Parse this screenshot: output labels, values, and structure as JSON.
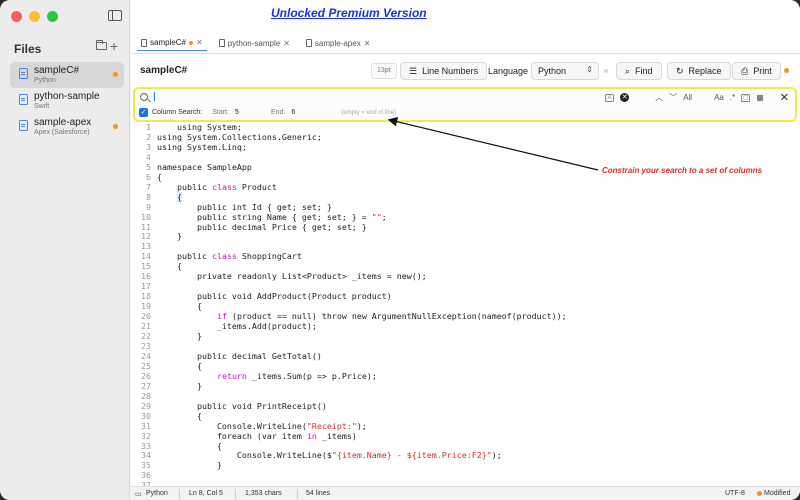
{
  "banner": "Unlocked Premium Version",
  "sidebar": {
    "title": "Files",
    "files": [
      {
        "name": "sampleC#",
        "lang": "Python",
        "active": true
      },
      {
        "name": "python-sample",
        "lang": "Swift",
        "active": false
      },
      {
        "name": "sample-apex",
        "lang": "Apex (Salesforce)",
        "active": false
      }
    ]
  },
  "tabs": [
    {
      "label": "sampleC#",
      "active": true
    },
    {
      "label": "python-sample",
      "active": false
    },
    {
      "label": "sample-apex",
      "active": false
    }
  ],
  "toolbar": {
    "doc_title": "sampleC#",
    "font_size": "13pt",
    "line_numbers": "Line Numbers",
    "language_label": "Language",
    "language_value": "Python",
    "find": "Find",
    "replace": "Replace",
    "print": "Print"
  },
  "search": {
    "value": "",
    "all_label": "All",
    "case_label": "Aa",
    "regex_label": ".*",
    "column_search_label": "Column Search:",
    "start_label": "Start:",
    "start_value": "5",
    "end_label": "End:",
    "end_value": "6",
    "end_hint": "(empty = end of line)"
  },
  "annotation": "Constrain your search to a set of columns",
  "code": {
    "lines": [
      {
        "n": "1",
        "html": "    using System;"
      },
      {
        "n": "2",
        "html": "using System.Collections.Generic;"
      },
      {
        "n": "3",
        "html": "using System.Linq;"
      },
      {
        "n": "4",
        "html": ""
      },
      {
        "n": "5",
        "html": "namespace SampleApp"
      },
      {
        "n": "6",
        "html": "{"
      },
      {
        "n": "7",
        "html": "    public <span class=\"kw\">class</span> Product"
      },
      {
        "n": "8",
        "html": "    <span class=\"hl\">{</span>"
      },
      {
        "n": "9",
        "html": "        public int Id { get; set; }"
      },
      {
        "n": "10",
        "html": "        public string Name { get; set; } = <span class=\"str\">\"\"</span>;"
      },
      {
        "n": "11",
        "html": "        public decimal Price { get; set; }"
      },
      {
        "n": "12",
        "html": "    }"
      },
      {
        "n": "13",
        "html": ""
      },
      {
        "n": "14",
        "html": "    public <span class=\"kw\">class</span> ShoppingCart"
      },
      {
        "n": "15",
        "html": "    {"
      },
      {
        "n": "16",
        "html": "        private readonly List&lt;Product&gt; _items = new();"
      },
      {
        "n": "17",
        "html": ""
      },
      {
        "n": "18",
        "html": "        public void AddProduct(Product product)"
      },
      {
        "n": "19",
        "html": "        {"
      },
      {
        "n": "20",
        "html": "            <span class=\"kw\">if</span> (product == null) throw new ArgumentNullException(nameof(product));"
      },
      {
        "n": "21",
        "html": "            _items.Add(product);"
      },
      {
        "n": "22",
        "html": "        }"
      },
      {
        "n": "23",
        "html": ""
      },
      {
        "n": "24",
        "html": "        public decimal GetTotal()"
      },
      {
        "n": "25",
        "html": "        {"
      },
      {
        "n": "26",
        "html": "            <span class=\"kw\">return</span> _items.Sum(p =&gt; p.Price);"
      },
      {
        "n": "27",
        "html": "        }"
      },
      {
        "n": "28",
        "html": ""
      },
      {
        "n": "29",
        "html": "        public void PrintReceipt()"
      },
      {
        "n": "30",
        "html": "        {"
      },
      {
        "n": "31",
        "html": "            Console.WriteLine(<span class=\"str\">\"Receipt:\"</span>);"
      },
      {
        "n": "32",
        "html": "            foreach (var item <span class=\"kw\">in</span> _items)"
      },
      {
        "n": "33",
        "html": "            {"
      },
      {
        "n": "34",
        "html": "                Console.WriteLine($<span class=\"str\">\"{item.Name} - ${item.Price:F2}\"</span>);"
      },
      {
        "n": "35",
        "html": "            }"
      },
      {
        "n": "36",
        "html": ""
      },
      {
        "n": "37",
        "html": ""
      }
    ]
  },
  "status": {
    "language": "Python",
    "position": "Ln 8, Col 5",
    "chars": "1,353 chars",
    "lines": "54 lines",
    "encoding": "UTF-8",
    "state": "Modified"
  },
  "colors": {
    "accent": "#1a73e8",
    "modified": "#f0952a",
    "search_highlight": "#eded4a",
    "keyword": "#c617b5",
    "string": "#d62b2b",
    "banner": "#1a33d6"
  }
}
